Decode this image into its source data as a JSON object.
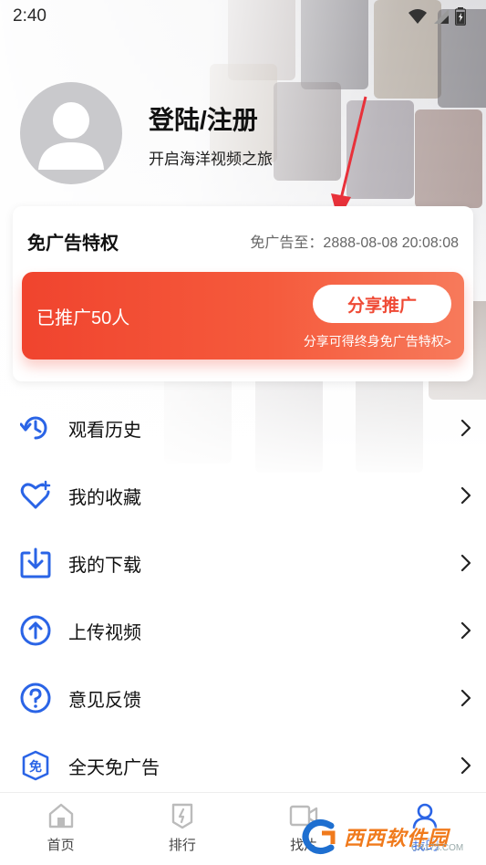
{
  "status_bar": {
    "time": "2:40"
  },
  "profile": {
    "login_title": "登陆/注册",
    "login_subtitle": "开启海洋视频之旅"
  },
  "vip_card": {
    "title": "免广告特权",
    "expire_label": "免广告至：2888-08-08 20:08:08",
    "promo_count": "已推广50人",
    "share_button": "分享推广",
    "share_hint": "分享可得终身免广告特权>"
  },
  "menu": {
    "items": [
      {
        "label": "观看历史",
        "icon": "history-icon"
      },
      {
        "label": "我的收藏",
        "icon": "favorite-heart-icon"
      },
      {
        "label": "我的下载",
        "icon": "download-icon"
      },
      {
        "label": "上传视频",
        "icon": "upload-icon"
      },
      {
        "label": "意见反馈",
        "icon": "feedback-question-icon"
      },
      {
        "label": "全天免广告",
        "icon": "ad-free-badge-icon"
      }
    ]
  },
  "bottom_nav": {
    "items": [
      {
        "label": "首页",
        "icon": "home-icon"
      },
      {
        "label": "排行",
        "icon": "ranking-icon"
      },
      {
        "label": "找片",
        "icon": "video-camera-icon"
      },
      {
        "label": "我的",
        "icon": "profile-icon"
      }
    ],
    "active_index": 3
  },
  "watermark": {
    "brand": "西西软件园",
    "domain": "CR173.COM"
  },
  "colors": {
    "accent_blue": "#2a64e6",
    "promo_red": "#f0442e",
    "annotation_red": "#e8313a"
  }
}
